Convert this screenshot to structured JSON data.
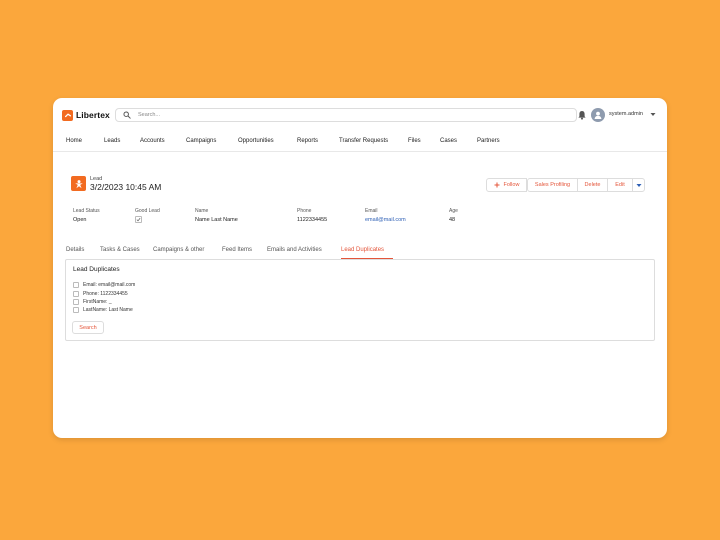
{
  "app": {
    "name": "Libertex"
  },
  "search": {
    "placeholder": "Search..."
  },
  "user": {
    "name": "system.admin"
  },
  "nav": {
    "items": [
      "Home",
      "Leads",
      "Accounts",
      "Campaigns",
      "Opportunities",
      "Reports",
      "Transfer Requests",
      "Files",
      "Cases",
      "Partners"
    ]
  },
  "record": {
    "type": "Lead",
    "title": "3/2/2023 10:45 AM",
    "actions": {
      "follow": "Follow",
      "sales_profiling": "Sales Profiling",
      "delete": "Delete",
      "edit": "Edit"
    },
    "fields": {
      "lead_status": {
        "label": "Lead Status",
        "value": "Open"
      },
      "good_lead": {
        "label": "Good Lead",
        "checked": true
      },
      "name": {
        "label": "Name",
        "value": "Name Last Name"
      },
      "phone": {
        "label": "Phone",
        "value": "1122334455"
      },
      "email": {
        "label": "Email",
        "value": "email@mail.com"
      },
      "age": {
        "label": "Age",
        "value": "48"
      }
    }
  },
  "tabs": [
    "Details",
    "Tasks & Cases",
    "Campaigns & other",
    "Feed Items",
    "Emails and Activities",
    "Lead Duplicates"
  ],
  "active_tab": "Lead Duplicates",
  "duplicates_panel": {
    "title": "Lead Duplicates",
    "criteria": [
      "Email: email@mail.com",
      "Phone: 1122334455",
      "FirstName: _",
      "LastName: Last Name"
    ],
    "button": "Search"
  },
  "colors": {
    "background": "#FBA73C",
    "brand": "#F26B21",
    "accent": "#E4553A",
    "link": "#2D5FB5"
  }
}
